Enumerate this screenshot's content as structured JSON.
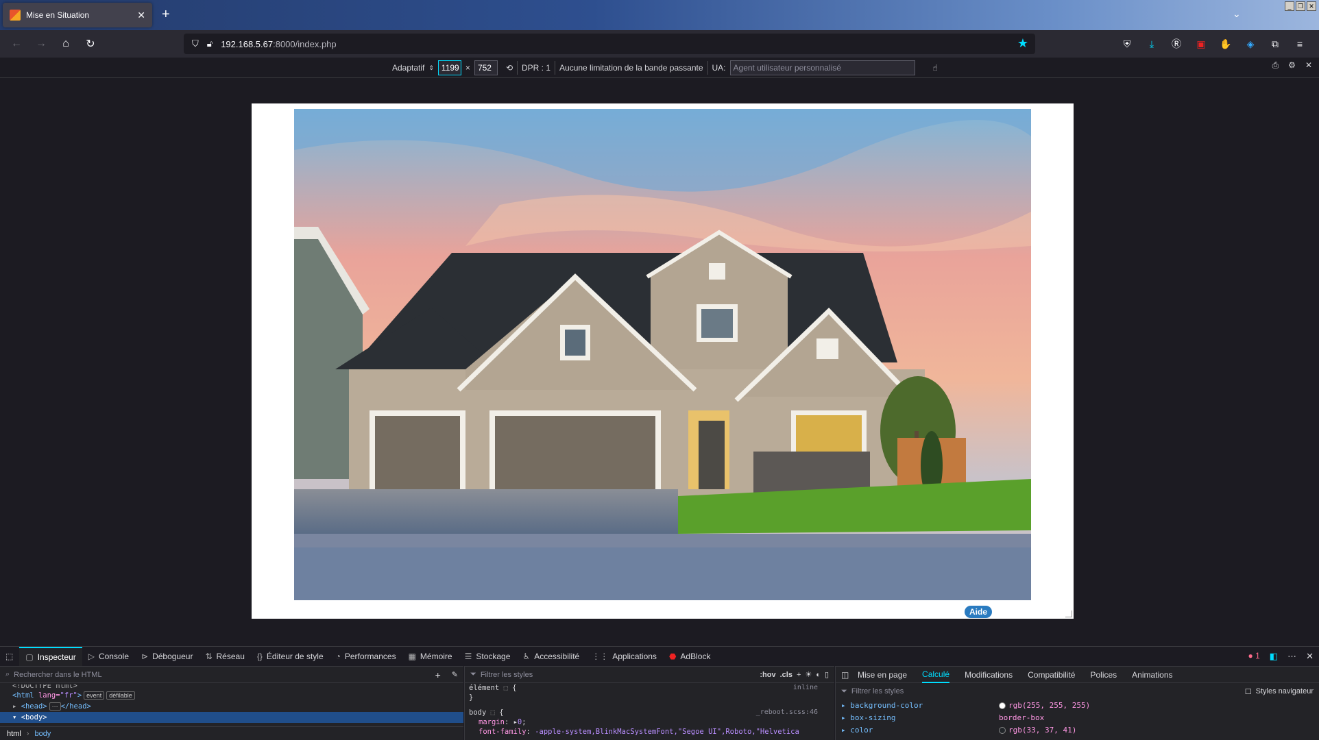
{
  "browser": {
    "tab_title": "Mise en Situation",
    "url_host": "192.168.5.67",
    "url_rest": ":8000/index.php"
  },
  "rdm": {
    "device": "Adaptatif",
    "width": "1199",
    "height": "752",
    "times": "×",
    "dpr": "DPR : 1",
    "throttle": "Aucune limitation de la bande passante",
    "ua_label": "UA:",
    "ua_placeholder": "Agent utilisateur personnalisé"
  },
  "page": {
    "help_button": "Aide"
  },
  "devtools": {
    "tabs": [
      {
        "label": "Inspecteur",
        "icon": "inspector-icon"
      },
      {
        "label": "Console",
        "icon": "console-icon"
      },
      {
        "label": "Débogueur",
        "icon": "debugger-icon"
      },
      {
        "label": "Réseau",
        "icon": "network-icon"
      },
      {
        "label": "Éditeur de style",
        "icon": "style-editor-icon"
      },
      {
        "label": "Performances",
        "icon": "performance-icon"
      },
      {
        "label": "Mémoire",
        "icon": "memory-icon"
      },
      {
        "label": "Stockage",
        "icon": "storage-icon"
      },
      {
        "label": "Accessibilité",
        "icon": "accessibility-icon"
      },
      {
        "label": "Applications",
        "icon": "applications-icon"
      },
      {
        "label": "AdBlock",
        "icon": "adblock-icon"
      }
    ],
    "error_count": "1",
    "html_search_placeholder": "Rechercher dans le HTML",
    "html_tree": {
      "doctype": "<!DOCTYPE html>",
      "html_tag": "<html",
      "lang_attr": "lang=",
      "lang_val": "\"fr\"",
      "badge_event": "event",
      "badge_scroll": "défilable",
      "head": "<head>",
      "head_close": "</head>",
      "body": "<body>"
    },
    "breadcrumb": [
      "html",
      "body"
    ],
    "styles_filter_placeholder": "Filtrer les styles",
    "hov": ":hov",
    "cls": ".cls",
    "rules": {
      "element_sel": "élément",
      "element_src": "inline",
      "body_sel": "body",
      "body_src": "_reboot.scss:46",
      "margin_prop": "margin",
      "margin_val": "0",
      "font_prop": "font-family",
      "font_val": "-apple-system,BlinkMacSystemFont,\"Segoe UI\",Roboto,\"Helvetica"
    },
    "subtabs": [
      "Mise en page",
      "Calculé",
      "Modifications",
      "Compatibilité",
      "Polices",
      "Animations"
    ],
    "computed_filter_placeholder": "Filtrer les styles",
    "browser_styles_label": "Styles navigateur",
    "computed": [
      {
        "prop": "background-color",
        "value": "rgb(255, 255, 255)",
        "swatch": "#ffffff"
      },
      {
        "prop": "box-sizing",
        "value": "border-box",
        "swatch": ""
      },
      {
        "prop": "color",
        "value": "rgb(33, 37, 41)",
        "swatch": "#212529"
      }
    ]
  }
}
